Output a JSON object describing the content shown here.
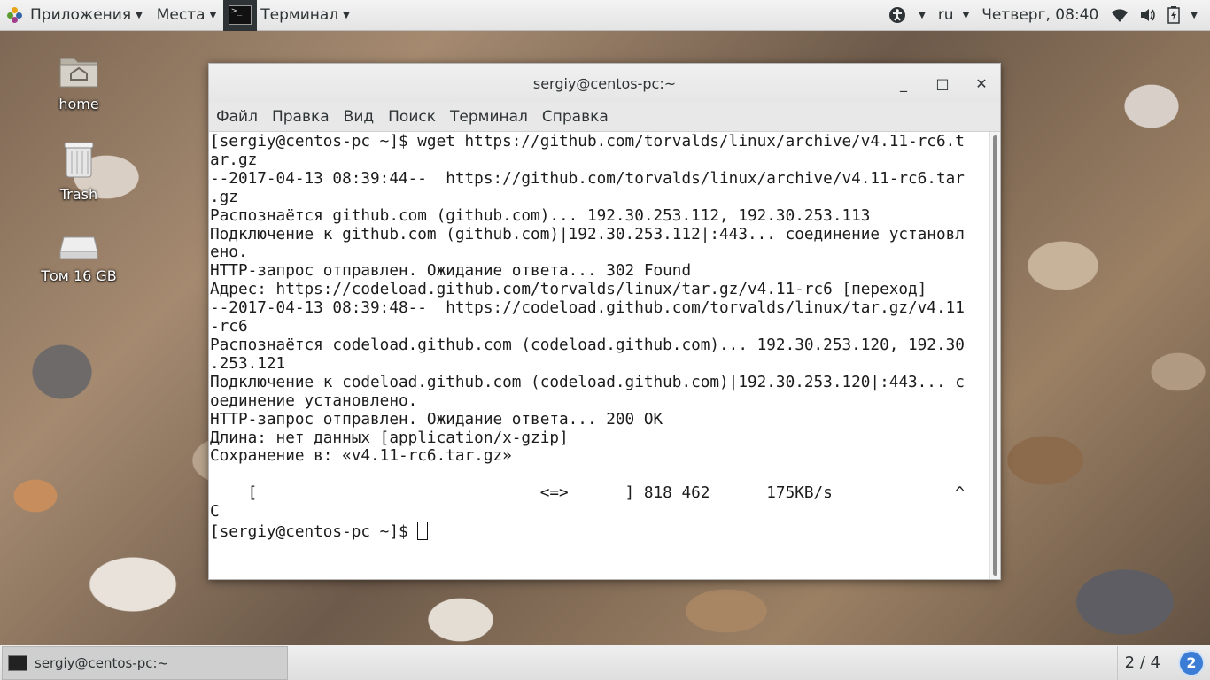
{
  "top_panel": {
    "apps_label": "Приложения",
    "places_label": "Места",
    "terminal_label": "Терминал",
    "lang": "ru",
    "clock": "Четверг, 08:40"
  },
  "desktop": {
    "icons": [
      {
        "label": "home"
      },
      {
        "label": "Trash"
      },
      {
        "label": "Том 16 GB"
      }
    ]
  },
  "window": {
    "title": "sergiy@centos-pc:~",
    "menu": [
      "Файл",
      "Правка",
      "Вид",
      "Поиск",
      "Терминал",
      "Справка"
    ],
    "lines": [
      "[sergiy@centos-pc ~]$ wget https://github.com/torvalds/linux/archive/v4.11-rc6.t",
      "ar.gz",
      "--2017-04-13 08:39:44--  https://github.com/torvalds/linux/archive/v4.11-rc6.tar",
      ".gz",
      "Распознаётся github.com (github.com)... 192.30.253.112, 192.30.253.113",
      "Подключение к github.com (github.com)|192.30.253.112|:443... соединение установл",
      "ено.",
      "HTTP-запрос отправлен. Ожидание ответа... 302 Found",
      "Адрес: https://codeload.github.com/torvalds/linux/tar.gz/v4.11-rc6 [переход]",
      "--2017-04-13 08:39:48--  https://codeload.github.com/torvalds/linux/tar.gz/v4.11",
      "-rc6",
      "Распознаётся codeload.github.com (codeload.github.com)... 192.30.253.120, 192.30",
      ".253.121",
      "Подключение к codeload.github.com (codeload.github.com)|192.30.253.120|:443... с",
      "оединение установлено.",
      "HTTP-запрос отправлен. Ожидание ответа... 200 OK",
      "Длина: нет данных [application/x-gzip]",
      "Сохранение в: «v4.11-rc6.tar.gz»",
      "",
      "    [                              <=>      ] 818 462      175KB/s             ^",
      "C"
    ],
    "prompt": "[sergiy@centos-pc ~]$ "
  },
  "bottom_panel": {
    "task_label": "sergiy@centos-pc:~",
    "workspace": "2 / 4",
    "notifications": "2"
  }
}
